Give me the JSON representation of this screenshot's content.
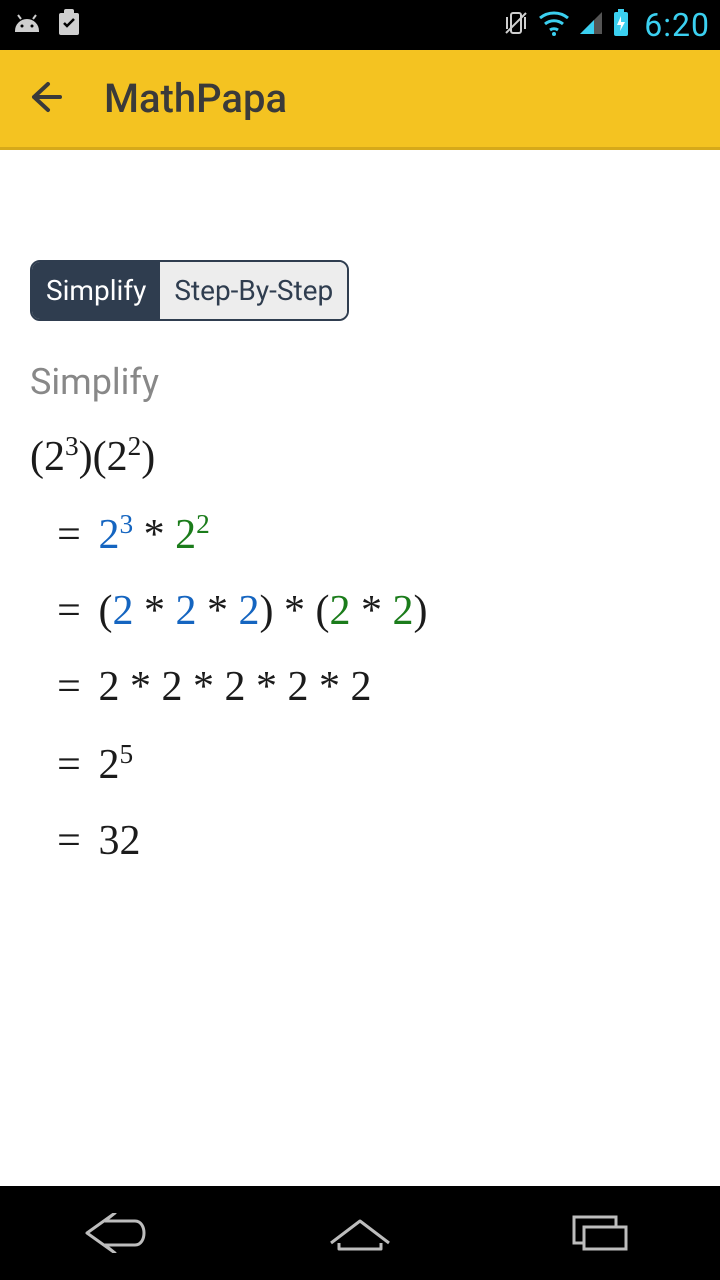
{
  "status": {
    "time": "6:20"
  },
  "appbar": {
    "title": "MathPapa"
  },
  "tabs": {
    "simplify": "Simplify",
    "step_by_step": "Step-By-Step"
  },
  "section": {
    "heading": "Simplify"
  },
  "expression": {
    "base1": "2",
    "exp1": "3",
    "base2": "2",
    "exp2": "2"
  },
  "steps": [
    {
      "type": "exp",
      "b1": "2",
      "e1": "3",
      "b2": "2",
      "e2": "2"
    },
    {
      "type": "expand2",
      "g1": [
        "2",
        "2",
        "2"
      ],
      "g2": [
        "2",
        "2"
      ]
    },
    {
      "type": "flat",
      "vals": [
        "2",
        "2",
        "2",
        "2",
        "2"
      ]
    },
    {
      "type": "power",
      "base": "2",
      "exp": "5"
    },
    {
      "type": "value",
      "val": "32"
    }
  ]
}
